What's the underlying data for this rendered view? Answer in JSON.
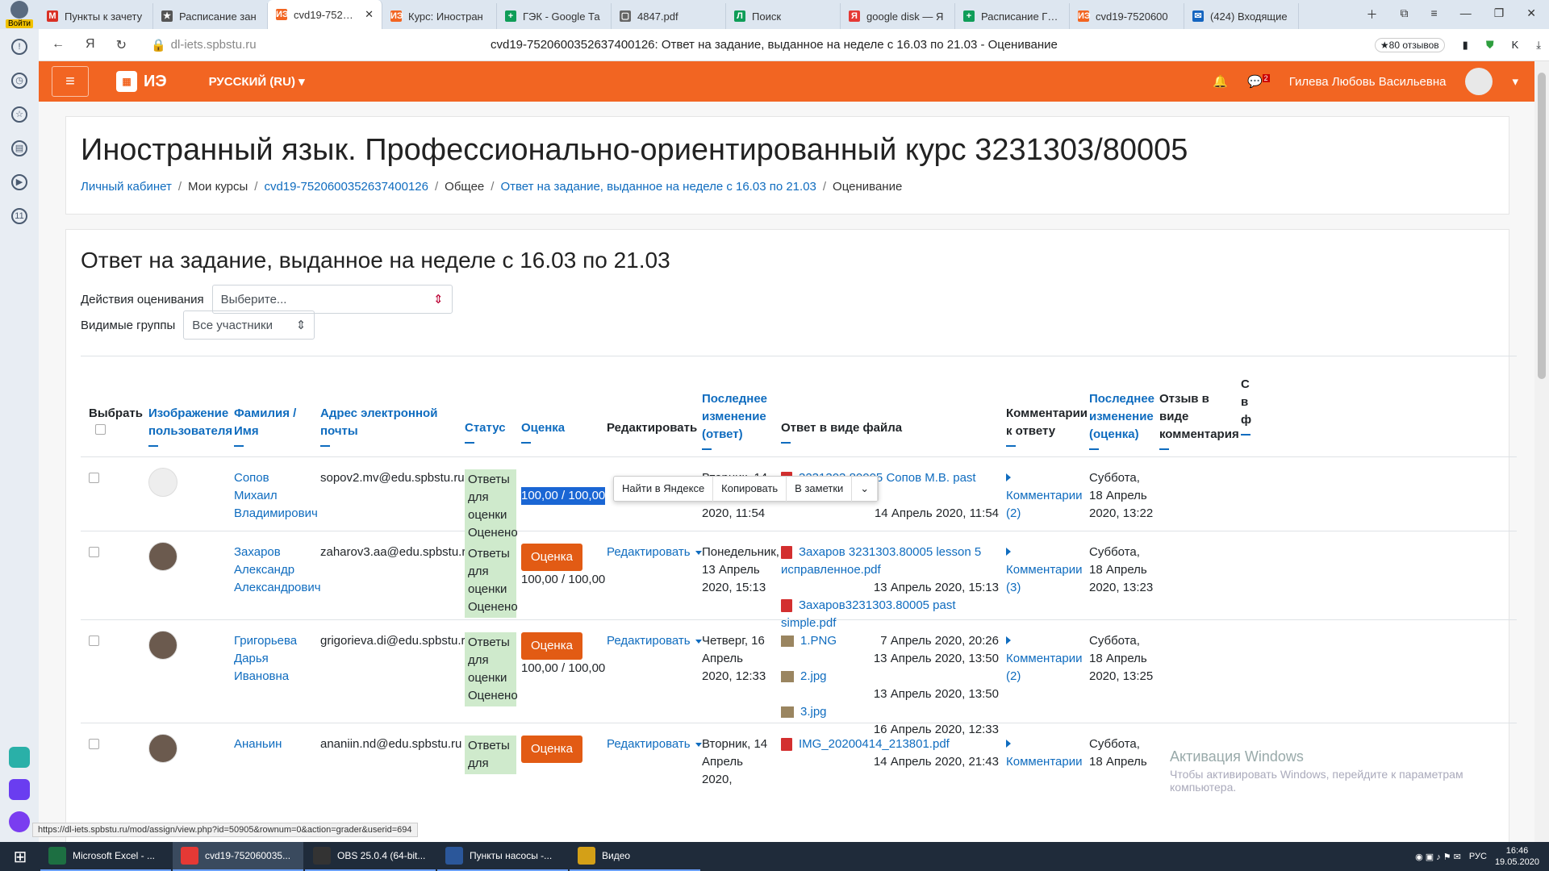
{
  "browser": {
    "profile_label": "Войти",
    "tabs": [
      {
        "label": "Пункты к зачету",
        "icon": "M",
        "color": "#d93025"
      },
      {
        "label": "Расписание зан",
        "icon": "★",
        "color": "#555"
      },
      {
        "label": "cvd19-752060",
        "icon": "ИЭ",
        "color": "#f26522",
        "active": true
      },
      {
        "label": "Курс: Иностран",
        "icon": "ИЭ",
        "color": "#f26522"
      },
      {
        "label": "ГЭК - Google Та",
        "icon": "+",
        "color": "#0f9d58"
      },
      {
        "label": "4847.pdf",
        "icon": "▢",
        "color": "#666"
      },
      {
        "label": "Поиск",
        "icon": "Л",
        "color": "#0f9d58"
      },
      {
        "label": "google disk — Я",
        "icon": "Я",
        "color": "#e53935"
      },
      {
        "label": "Расписание ГИА",
        "icon": "+",
        "color": "#0f9d58"
      },
      {
        "label": "cvd19-7520600",
        "icon": "ИЭ",
        "color": "#f26522"
      },
      {
        "label": "(424) Входящие",
        "icon": "✉",
        "color": "#1565c0"
      }
    ],
    "url": "dl-iets.spbstu.ru",
    "page_title": "cvd19-752060035263740012​6: Ответ на задание, выданное на неделе с 16.03 по 21.03 - Оценивание",
    "reviews": "★80 отзывов",
    "status_url": "https://dl-iets.spbstu.ru/mod/assign/view.php?id=50905&rownum=0&action=grader&userid=694"
  },
  "moodle": {
    "logo": "ИЭ",
    "language": "РУССКИЙ (RU)",
    "user": "Гилева Любовь Васильевна",
    "msg_count": "2"
  },
  "course": {
    "title": "Иностранный язык. Профессионально-ориентированный курс 3231303/80005",
    "breadcrumb": [
      "Личный кабинет",
      "Мои курсы",
      "cvd19-752060035263740012​6",
      "Общее",
      "Ответ на задание, выданное на неделе с 16.03 по 21.03",
      "Оценивание"
    ]
  },
  "assign": {
    "title": "Ответ на задание, выданное на неделе с 16.03 по 21.03",
    "grading_actions_label": "Действия оценивания",
    "grading_actions_value": "Выберите...",
    "groups_label": "Видимые группы",
    "groups_value": "Все участники"
  },
  "table": {
    "headers": {
      "select": "Выбрать",
      "picture": "Изображение пользователя",
      "name": "Фамилия / Имя",
      "email": "Адрес электронной почты",
      "status": "Статус",
      "grade": "Оценка",
      "edit": "Редактировать",
      "last_submission": "Последнее изменение (ответ)",
      "files": "Ответ в виде файла",
      "comments": "Комментарии к ответу",
      "last_grade": "Последнее изменение (оценка)",
      "feedback": "Отзыв в виде комментария",
      "extra": "С в ф"
    },
    "grade_btn": "Оценка",
    "edit_link": "Редактировать",
    "rows": [
      {
        "name": "Сопов Михаил Владимирович",
        "email": "sopov2.mv@edu.spbstu.ru",
        "status": "Ответы для оценки Оценено",
        "grade": "100,00 / 100,00",
        "submitted": "Вторник, 14 Апрель 2020, 11:54",
        "files": [
          {
            "name": "3231303.80005 Сопов М.В. past simple.pdf",
            "date": "14 Апрель 2020, 11:54",
            "type": "pdf"
          }
        ],
        "comments": "Комментарии (2)",
        "graded": "Суббота, 18 Апрель 2020, 13:22"
      },
      {
        "name": "Захаров Александр Александрович",
        "email": "zaharov3.aa@edu.spbstu.ru",
        "status": "Ответы для оценки Оценено",
        "grade": "100,00 / 100,00",
        "submitted": "Понедельник, 13 Апрель 2020, 15:13",
        "files": [
          {
            "name": "Захаров 3231303.80005 lesson 5 исправленное.pdf",
            "date": "13 Апрель 2020, 15:13",
            "type": "pdf"
          },
          {
            "name": "Захаров3231303.80005 past simple.pdf",
            "date": "7 Апрель 2020, 20:26",
            "type": "pdf"
          }
        ],
        "comments": "Комментарии (3)",
        "graded": "Суббота, 18 Апрель 2020, 13:23"
      },
      {
        "name": "Григорьева Дарья Ивановна",
        "email": "grigorieva.di@edu.spbstu.ru",
        "status": "Ответы для оценки Оценено",
        "grade": "100,00 / 100,00",
        "submitted": "Четверг, 16 Апрель 2020, 12:33",
        "files": [
          {
            "name": "1.PNG",
            "date": "13 Апрель 2020, 13:50",
            "type": "img"
          },
          {
            "name": "2.jpg",
            "date": "13 Апрель 2020, 13:50",
            "type": "img"
          },
          {
            "name": "3.jpg",
            "date": "16 Апрель 2020, 12:33",
            "type": "img"
          }
        ],
        "comments": "Комментарии (2)",
        "graded": "Суббота, 18 Апрель 2020, 13:25"
      },
      {
        "name": "Ананьин",
        "email": "ananiin.nd@edu.spbstu.ru",
        "status": "Ответы для",
        "grade": "",
        "submitted": "Вторник, 14 Апрель 2020,",
        "files": [
          {
            "name": "IMG_20200414_213801.pdf",
            "date": "14 Апрель 2020, 21:43",
            "type": "pdf"
          }
        ],
        "comments": "Комментарии",
        "graded": "Суббота, 18 Апрель"
      }
    ]
  },
  "context_menu": [
    "Найти в Яндексе",
    "Копировать",
    "В заметки"
  ],
  "watermark": {
    "title": "Активация Windows",
    "text": "Чтобы активировать Windows, перейдите к параметрам компьютера."
  },
  "taskbar": {
    "items": [
      {
        "label": "Microsoft Excel - ...",
        "color": "#1d6f42"
      },
      {
        "label": "cvd19-752060035...",
        "color": "#e53935",
        "active": true
      },
      {
        "label": "OBS 25.0.4 (64-bit...",
        "color": "#333"
      },
      {
        "label": "Пункты насосы -...",
        "color": "#2b579a"
      },
      {
        "label": "Видео",
        "color": "#d4a017"
      }
    ],
    "lang": "РУС",
    "time": "16:46",
    "date": "19.05.2020"
  }
}
